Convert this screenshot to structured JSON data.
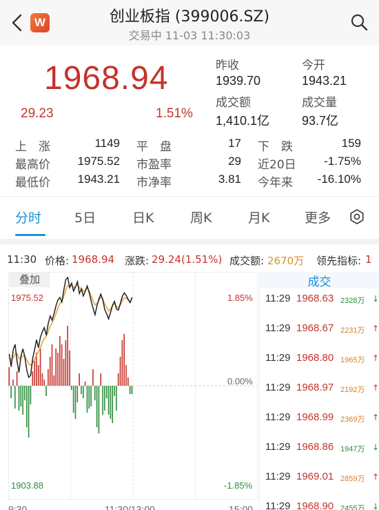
{
  "header": {
    "title": "创业板指 (399006.SZ)",
    "status": "交易中 11-03 11:30:03",
    "logo_text": "W"
  },
  "quote": {
    "price": "1968.94",
    "change": "29.23",
    "change_pct": "1.51%",
    "prev_close_label": "昨收",
    "prev_close": "1939.70",
    "open_label": "今开",
    "open": "1943.21",
    "turnover_label": "成交额",
    "turnover": "1,410.1亿",
    "volume_label": "成交量",
    "volume": "93.7亿"
  },
  "stats": {
    "rows": [
      [
        {
          "label": "上　涨",
          "value": "1149"
        },
        {
          "label": "平　盘",
          "value": "17"
        },
        {
          "label": "下　跌",
          "value": "159"
        }
      ],
      [
        {
          "label": "最高价",
          "value": "1975.52"
        },
        {
          "label": "市盈率",
          "value": "29"
        },
        {
          "label": "近20日",
          "value": "-1.75%"
        }
      ],
      [
        {
          "label": "最低价",
          "value": "1943.21"
        },
        {
          "label": "市净率",
          "value": "3.81"
        },
        {
          "label": "今年来",
          "value": "-16.10%"
        }
      ]
    ]
  },
  "tabs": [
    "分时",
    "5日",
    "日K",
    "周K",
    "月K",
    "更多"
  ],
  "infobar": {
    "time": "11:30",
    "price_label": "价格:",
    "price": "1968.94",
    "change_label": "涨跌:",
    "change": "29.24(1.51%)",
    "amount_label": "成交额:",
    "amount": "2670万",
    "lead_label": "领先指标:",
    "lead": "1"
  },
  "overlay_label": "叠加",
  "chart_axis": {
    "high": "1975.52",
    "low": "1903.88",
    "high_pct": "1.85%",
    "mid_pct": "0.00%",
    "low_pct": "-1.85%",
    "t_start": "9:30",
    "t_mid": "11:30/13:00",
    "t_end": "15:00"
  },
  "chart_data": {
    "type": "line",
    "y_range": [
      1903.88,
      1975.52
    ],
    "base": 1939.7,
    "price": [
      1950.2,
      1946.0,
      1951.5,
      1953.4,
      1947.8,
      1944.1,
      1949.5,
      1951.9,
      1949.3,
      1944.8,
      1942.5,
      1943.2,
      1948.7,
      1951.6,
      1954.9,
      1952.3,
      1955.8,
      1957.6,
      1958.9,
      1956.4,
      1960.3,
      1962.8,
      1961.4,
      1963.6,
      1966.2,
      1968.1,
      1968.9,
      1967.4,
      1971.3,
      1974.8,
      1975.5,
      1972.2,
      1973.6,
      1971.0,
      1972.4,
      1974.1,
      1970.2,
      1971.7,
      1969.4,
      1970.9,
      1972.7,
      1970.5,
      1967.8,
      1965.4,
      1963.2,
      1966.1,
      1968.4,
      1970.0,
      1968.1,
      1964.9,
      1963.5,
      1961.8,
      1964.0,
      1966.3,
      1967.6,
      1965.1,
      1964.7,
      1966.9,
      1969.2,
      1970.4,
      1969.6,
      1968.3,
      1967.2,
      1968.94
    ],
    "avg": [
      1949.0,
      1948.2,
      1949.0,
      1950.2,
      1950.4,
      1948.6,
      1948.9,
      1949.6,
      1949.5,
      1948.2,
      1947.0,
      1946.5,
      1947.3,
      1948.4,
      1949.9,
      1951.0,
      1952.5,
      1954.0,
      1955.3,
      1956.0,
      1957.6,
      1959.4,
      1960.5,
      1961.9,
      1963.6,
      1965.5,
      1966.9,
      1967.6,
      1969.2,
      1971.4,
      1972.8,
      1972.6,
      1973.0,
      1972.2,
      1972.5,
      1973.3,
      1972.0,
      1972.0,
      1970.9,
      1971.3,
      1972.0,
      1971.1,
      1969.5,
      1967.9,
      1966.4,
      1966.9,
      1967.9,
      1969.0,
      1968.4,
      1966.6,
      1965.7,
      1964.4,
      1965.1,
      1966.1,
      1966.9,
      1965.9,
      1965.5,
      1966.4,
      1967.8,
      1968.8,
      1968.7,
      1968.1,
      1967.5,
      1968.3
    ],
    "lead": [
      9,
      -6,
      3,
      -11,
      7,
      -12,
      -10,
      -14,
      -7,
      -20,
      -25,
      -9,
      7,
      12,
      16,
      10,
      18,
      6,
      3,
      -5,
      8,
      14,
      20,
      5,
      18,
      16,
      24,
      20,
      13,
      22,
      29,
      17,
      -2,
      -13,
      -16,
      -8,
      6,
      -4,
      -6,
      2,
      -13,
      -11,
      -10,
      8,
      -7,
      -20,
      -23,
      6,
      -14,
      -12,
      -6,
      -14,
      -16,
      -18,
      -5,
      -12,
      6,
      14,
      22,
      25,
      10,
      4,
      -4,
      -4
    ]
  },
  "trades": {
    "header": "成交",
    "items": [
      {
        "time": "11:29",
        "price": "1968.63",
        "vol": "2328万",
        "dir": "down"
      },
      {
        "time": "11:29",
        "price": "1968.67",
        "vol": "2231万",
        "dir": "up"
      },
      {
        "time": "11:29",
        "price": "1968.80",
        "vol": "1965万",
        "dir": "up"
      },
      {
        "time": "11:29",
        "price": "1968.97",
        "vol": "2192万",
        "dir": "up"
      },
      {
        "time": "11:29",
        "price": "1968.99",
        "vol": "2369万",
        "dir": "up"
      },
      {
        "time": "11:29",
        "price": "1968.86",
        "vol": "1947万",
        "dir": "down"
      },
      {
        "time": "11:29",
        "price": "1969.01",
        "vol": "2859万",
        "dir": "up"
      },
      {
        "time": "11:29",
        "price": "1968.90",
        "vol": "2455万",
        "dir": "down"
      }
    ]
  },
  "colors": {
    "up": "#c4332b",
    "down": "#2e8b3e",
    "accent": "#1f8fd6",
    "avg_line": "#e3a23a",
    "price_line": "#222222",
    "vol_up": "#d67f2a"
  }
}
